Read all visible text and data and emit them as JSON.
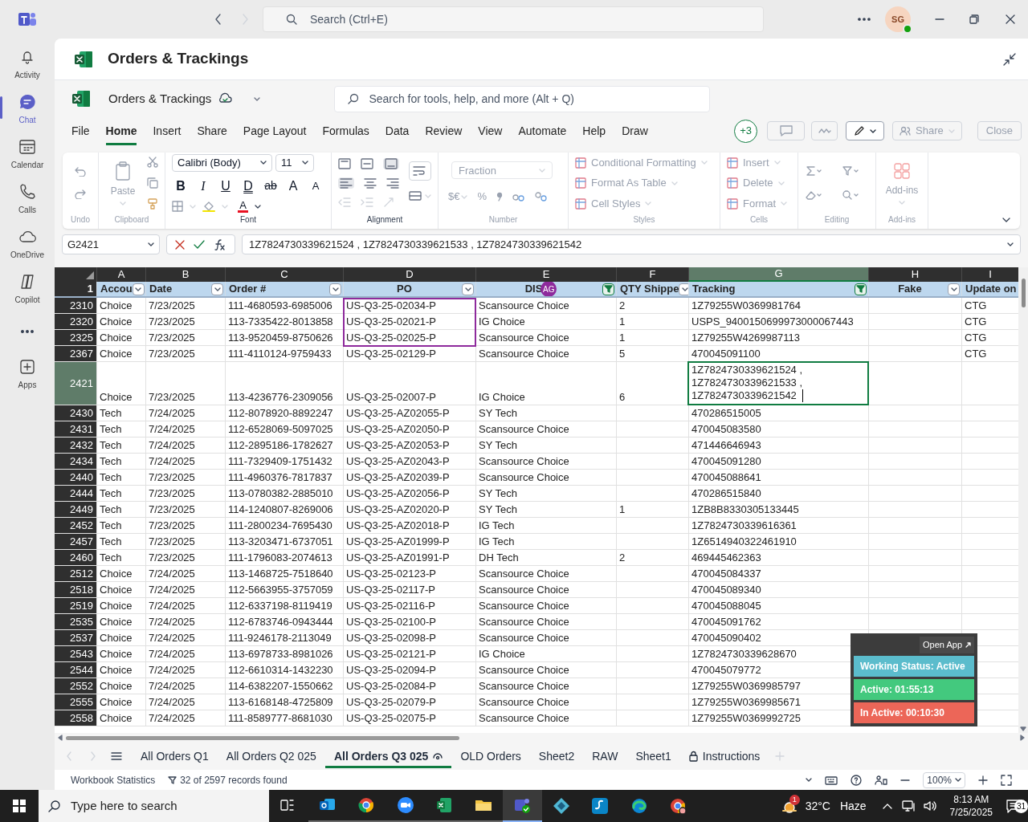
{
  "teams": {
    "search_placeholder": "Search (Ctrl+E)",
    "avatar": "SG"
  },
  "rail": [
    {
      "label": "Activity",
      "selected": false
    },
    {
      "label": "Chat",
      "selected": true
    },
    {
      "label": "Calendar",
      "selected": false
    },
    {
      "label": "Calls",
      "selected": false
    },
    {
      "label": "OneDrive",
      "selected": false
    },
    {
      "label": "Copilot",
      "selected": false
    },
    {
      "label": "Apps",
      "selected": false
    }
  ],
  "app_title": "Orders & Trackings",
  "excel": {
    "doc_title": "Orders & Trackings",
    "search_placeholder": "Search for tools, help, and more (Alt + Q)",
    "menu": [
      {
        "label": "File",
        "selected": false
      },
      {
        "label": "Home",
        "selected": true
      },
      {
        "label": "Insert",
        "selected": false
      },
      {
        "label": "Share",
        "selected": false
      },
      {
        "label": "Page Layout",
        "selected": false
      },
      {
        "label": "Formulas",
        "selected": false
      },
      {
        "label": "Data",
        "selected": false
      },
      {
        "label": "Review",
        "selected": false
      },
      {
        "label": "View",
        "selected": false
      },
      {
        "label": "Automate",
        "selected": false
      },
      {
        "label": "Help",
        "selected": false
      },
      {
        "label": "Draw",
        "selected": false
      }
    ],
    "coauthors": "+3",
    "actions": [
      {
        "label": "Share",
        "disabled": true
      },
      {
        "label": "Close",
        "disabled": true
      }
    ],
    "ribbon": [
      {
        "kind": "undo",
        "label": "Undo",
        "disabled": true
      },
      {
        "kind": "clipboard",
        "label": "Clipboard",
        "button": "Paste",
        "disabled": true
      },
      {
        "kind": "font",
        "label": "Font",
        "font": "Calibri (Body)",
        "size": "11",
        "disabled": false,
        "buttons": [
          {
            "text": "B",
            "kind": "bold"
          },
          {
            "text": "I",
            "kind": "italic"
          },
          {
            "text": "U",
            "kind": "underline"
          },
          {
            "text": "D",
            "kind": "double"
          },
          {
            "text": "ab",
            "kind": "strike"
          },
          {
            "text": "A",
            "kind": "grow"
          },
          {
            "text": "A",
            "kind": "shrink"
          }
        ],
        "font_color": {
          "text": "A",
          "color": "#e81123"
        }
      },
      {
        "kind": "alignment",
        "label": "Alignment",
        "disabled": false
      },
      {
        "kind": "number",
        "label": "Number",
        "format": "Fraction",
        "symbols": [
          "$€",
          "%"
        ],
        "disabled": true
      },
      {
        "kind": "commands",
        "label": "Styles",
        "commands": [
          "Conditional Formatting",
          "Format As Table",
          "Cell Styles"
        ],
        "disabled": true
      },
      {
        "kind": "commands",
        "label": "Cells",
        "commands": [
          "Insert",
          "Delete",
          "Format"
        ],
        "disabled": true
      },
      {
        "kind": "editing",
        "label": "Editing",
        "disabled": true
      },
      {
        "kind": "addins",
        "label": "Add-ins",
        "button": "Add-ins",
        "disabled": true
      }
    ],
    "name_box": "G2421",
    "formula": "1Z7824730339621524 , 1Z7824730339621533 , 1Z7824730339621542"
  },
  "sheet": {
    "collaborator": {
      "initials": "AG",
      "color": "#8e2a9c"
    },
    "columns": [
      {
        "letter": "A",
        "selected": false
      },
      {
        "letter": "B",
        "selected": false
      },
      {
        "letter": "C",
        "selected": false
      },
      {
        "letter": "D",
        "selected": false
      },
      {
        "letter": "E",
        "selected": false
      },
      {
        "letter": "F",
        "selected": false
      },
      {
        "letter": "G",
        "selected": true
      },
      {
        "letter": "H",
        "selected": false
      },
      {
        "letter": "I",
        "selected": false
      }
    ],
    "header_row": {
      "number": "1",
      "cells": [
        {
          "text": "Accou",
          "has_filter": true,
          "filter_applied": false,
          "centered": false
        },
        {
          "text": "Date",
          "has_filter": true,
          "filter_applied": false,
          "centered": false
        },
        {
          "text": "Order #",
          "has_filter": true,
          "filter_applied": false,
          "centered": false
        },
        {
          "text": "PO",
          "has_filter": true,
          "filter_applied": false,
          "centered": true
        },
        {
          "text": "DIS",
          "has_filter": true,
          "filter_applied": true,
          "centered": true,
          "badge": true
        },
        {
          "text": "QTY Shippe",
          "has_filter": true,
          "filter_applied": false,
          "centered": false
        },
        {
          "text": "Tracking",
          "has_filter": true,
          "filter_applied": true,
          "centered": false
        },
        {
          "text": "Fake",
          "has_filter": true,
          "filter_applied": false,
          "centered": true
        },
        {
          "text": "Update on",
          "centered": false
        }
      ]
    },
    "rows": [
      {
        "number": "2310",
        "selected": false,
        "cells": {
          "A": "Choice",
          "B": "7/23/2025",
          "C": "111-4680593-6985006",
          "D": "US-Q3-25-02034-P",
          "E": "Scansource Choice",
          "F": "2",
          "G": "1Z79255W0369981764",
          "I": "CTG"
        }
      },
      {
        "number": "2320",
        "selected": false,
        "cells": {
          "A": "Choice",
          "B": "7/23/2025",
          "C": "113-7335422-8013858",
          "D": "US-Q3-25-02021-P",
          "E": "IG Choice",
          "F": "1",
          "G": "USPS_9400150699973000067443",
          "I": "CTG"
        }
      },
      {
        "number": "2325",
        "selected": false,
        "cells": {
          "A": "Choice",
          "B": "7/23/2025",
          "C": "113-9520459-8750626",
          "D": "US-Q3-25-02025-P",
          "E": "Scansource Choice",
          "F": "1",
          "G": "1Z79255W4269987113",
          "I": "CTG"
        }
      },
      {
        "number": "2367",
        "selected": false,
        "cells": {
          "A": "Choice",
          "B": "7/23/2025",
          "C": "111-4110124-9759433",
          "D": "US-Q3-25-02129-P",
          "E": "Scansource Choice",
          "F": "5",
          "G": "470045091100",
          "I": "CTG"
        }
      },
      {
        "number": "2421",
        "selected": true,
        "cells": {
          "A": "Choice",
          "B": "7/23/2025",
          "C": "113-4236776-2309056",
          "D": "US-Q3-25-02007-P",
          "E": "IG Choice",
          "F": "6",
          "G": "1Z7824730339621524 ,\n1Z7824730339621533 ,\n1Z7824730339621542"
        }
      },
      {
        "number": "2430",
        "selected": false,
        "cells": {
          "A": "Tech",
          "B": "7/24/2025",
          "C": "112-8078920-8892247",
          "D": "US-Q3-25-AZ02055-P",
          "E": "SY Tech",
          "G": "470286515005"
        }
      },
      {
        "number": "2431",
        "selected": false,
        "cells": {
          "A": "Tech",
          "B": "7/24/2025",
          "C": "112-6528069-5097025",
          "D": "US-Q3-25-AZ02050-P",
          "E": "Scansource Choice",
          "G": "470045083580"
        }
      },
      {
        "number": "2432",
        "selected": false,
        "cells": {
          "A": "Tech",
          "B": "7/24/2025",
          "C": "112-2895186-1782627",
          "D": "US-Q3-25-AZ02053-P",
          "E": "SY Tech",
          "G": "471446646943"
        }
      },
      {
        "number": "2434",
        "selected": false,
        "cells": {
          "A": "Tech",
          "B": "7/24/2025",
          "C": "111-7329409-1751432",
          "D": "US-Q3-25-AZ02043-P",
          "E": "Scansource Choice",
          "G": "470045091280"
        }
      },
      {
        "number": "2440",
        "selected": false,
        "cells": {
          "A": "Tech",
          "B": "7/23/2025",
          "C": "111-4960376-7817837",
          "D": "US-Q3-25-AZ02039-P",
          "E": "Scansource Choice",
          "G": "470045088641"
        }
      },
      {
        "number": "2444",
        "selected": false,
        "cells": {
          "A": "Tech",
          "B": "7/23/2025",
          "C": "113-0780382-2885010",
          "D": "US-Q3-25-AZ02056-P",
          "E": "SY Tech",
          "G": "470286515840"
        }
      },
      {
        "number": "2449",
        "selected": false,
        "cells": {
          "A": "Tech",
          "B": "7/23/2025",
          "C": "114-1240807-8269006",
          "D": "US-Q3-25-AZ02020-P",
          "E": "SY Tech",
          "F": "1",
          "G": "1ZB8B8330305133445"
        }
      },
      {
        "number": "2452",
        "selected": false,
        "cells": {
          "A": "Tech",
          "B": "7/23/2025",
          "C": "111-2800234-7695430",
          "D": "US-Q3-25-AZ02018-P",
          "E": "IG Tech",
          "G": "1Z7824730339616361"
        }
      },
      {
        "number": "2457",
        "selected": false,
        "cells": {
          "A": "Tech",
          "B": "7/23/2025",
          "C": "113-3203471-6737051",
          "D": "US-Q3-25-AZ01999-P",
          "E": "IG Tech",
          "G": "1Z6514940322461910"
        }
      },
      {
        "number": "2460",
        "selected": false,
        "cells": {
          "A": "Tech",
          "B": "7/23/2025",
          "C": "111-1796083-2074613",
          "D": "US-Q3-25-AZ01991-P",
          "E": "DH Tech",
          "F": "2",
          "G": "469445462363"
        }
      },
      {
        "number": "2512",
        "selected": false,
        "cells": {
          "A": "Choice",
          "B": "7/24/2025",
          "C": "113-1468725-7518640",
          "D": "US-Q3-25-02123-P",
          "E": "Scansource Choice",
          "G": "470045084337"
        }
      },
      {
        "number": "2518",
        "selected": false,
        "cells": {
          "A": "Choice",
          "B": "7/24/2025",
          "C": "112-5663955-3757059",
          "D": "US-Q3-25-02117-P",
          "E": "Scansource Choice",
          "G": "470045089340"
        }
      },
      {
        "number": "2519",
        "selected": false,
        "cells": {
          "A": "Choice",
          "B": "7/24/2025",
          "C": "112-6337198-8119419",
          "D": "US-Q3-25-02116-P",
          "E": "Scansource Choice",
          "G": "470045088045"
        }
      },
      {
        "number": "2535",
        "selected": false,
        "cells": {
          "A": "Choice",
          "B": "7/24/2025",
          "C": "112-6783746-0943444",
          "D": "US-Q3-25-02100-P",
          "E": "Scansource Choice",
          "G": "470045091762"
        }
      },
      {
        "number": "2537",
        "selected": false,
        "cells": {
          "A": "Choice",
          "B": "7/24/2025",
          "C": "111-9246178-2113049",
          "D": "US-Q3-25-02098-P",
          "E": "Scansource Choice",
          "G": "470045090402"
        }
      },
      {
        "number": "2543",
        "selected": false,
        "cells": {
          "A": "Choice",
          "B": "7/24/2025",
          "C": "113-6978733-8981026",
          "D": "US-Q3-25-02121-P",
          "E": "IG Choice",
          "G": "1Z7824730339628670"
        }
      },
      {
        "number": "2544",
        "selected": false,
        "cells": {
          "A": "Choice",
          "B": "7/24/2025",
          "C": "112-6610314-1432230",
          "D": "US-Q3-25-02094-P",
          "E": "Scansource Choice",
          "G": "470045079772"
        }
      },
      {
        "number": "2552",
        "selected": false,
        "cells": {
          "A": "Choice",
          "B": "7/24/2025",
          "C": "114-6382207-1550662",
          "D": "US-Q3-25-02084-P",
          "E": "Scansource Choice",
          "G": "1Z79255W0369985797"
        }
      },
      {
        "number": "2555",
        "selected": false,
        "cells": {
          "A": "Choice",
          "B": "7/24/2025",
          "C": "113-6168148-4725809",
          "D": "US-Q3-25-02079-P",
          "E": "Scansource Choice",
          "G": "1Z79255W0369985671"
        }
      },
      {
        "number": "2558",
        "selected": false,
        "cells": {
          "A": "Choice",
          "B": "7/24/2025",
          "C": "111-8589777-8681030",
          "D": "US-Q3-25-02075-P",
          "E": "Scansource Choice",
          "G": "1Z79255W0369992725"
        }
      }
    ]
  },
  "widget": {
    "link": "Open App",
    "statuses": [
      {
        "text": "Working Status: Active",
        "color": "#5bbccc"
      },
      {
        "text": "Active: 01:55:13",
        "color": "#43c97e"
      },
      {
        "text": "In Active: 00:10:30",
        "color": "#ec6658"
      }
    ]
  },
  "sheet_tabs": [
    {
      "label": "All Orders Q1",
      "selected": false
    },
    {
      "label": "All Orders Q2 025",
      "selected": false
    },
    {
      "label": "All Orders Q3 025",
      "selected": true
    },
    {
      "label": "OLD Orders",
      "selected": false
    },
    {
      "label": "Sheet2",
      "selected": false
    },
    {
      "label": "RAW",
      "selected": false
    },
    {
      "label": "Sheet1",
      "selected": false
    },
    {
      "label": "Instructions",
      "selected": false,
      "locked": true
    }
  ],
  "status_bar": {
    "statistics": "Workbook Statistics",
    "records": "32 of 2597 records found",
    "zoom": "100%"
  },
  "taskbar": {
    "search_placeholder": "Type here to search",
    "weather_badge": "1",
    "temperature": "32°C",
    "weather": "Haze",
    "time": "8:13 AM",
    "date": "7/25/2025",
    "notifications": "31"
  }
}
